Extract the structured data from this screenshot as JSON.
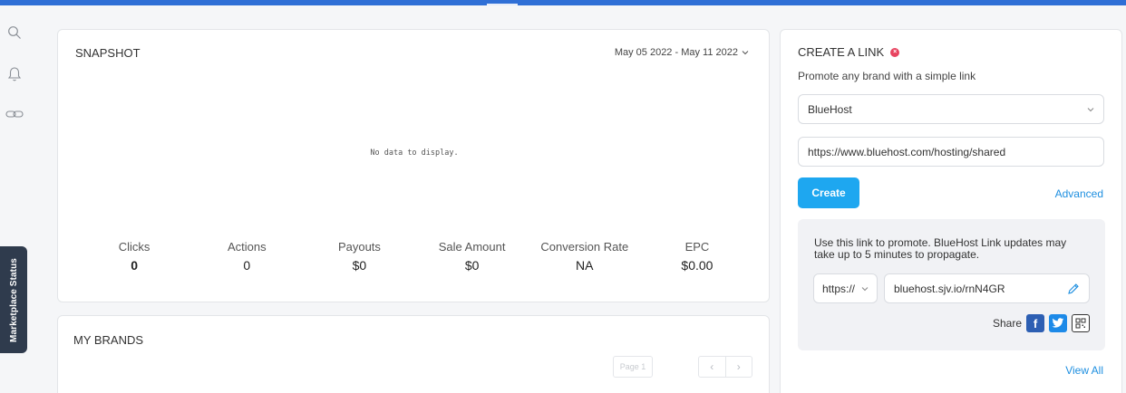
{
  "snapshot": {
    "title": "SNAPSHOT",
    "date_range": "May 05 2022 - May 11 2022",
    "empty_message": "No data to display.",
    "stats": [
      {
        "label": "Clicks",
        "value": "0"
      },
      {
        "label": "Actions",
        "value": "0"
      },
      {
        "label": "Payouts",
        "value": "$0"
      },
      {
        "label": "Sale Amount",
        "value": "$0"
      },
      {
        "label": "Conversion Rate",
        "value": "NA"
      },
      {
        "label": "EPC",
        "value": "$0.00"
      }
    ]
  },
  "brands": {
    "title": "MY BRANDS",
    "page_label": "Page 1",
    "prev": "‹",
    "next": "›"
  },
  "create_link": {
    "title": "CREATE A LINK",
    "subtitle": "Promote any brand with a simple link",
    "brand_select": "BlueHost",
    "destination_url": "https://www.bluehost.com/hosting/shared",
    "create_label": "Create",
    "advanced_label": "Advanced",
    "promo_text": "Use this link to promote. BlueHost Link updates may take up to 5 minutes to propagate.",
    "protocol": "https://",
    "short_url": "bluehost.sjv.io/rnN4GR",
    "share_label": "Share",
    "view_all_label": "View All"
  },
  "sidebar": {
    "marketplace_status": "Marketplace Status"
  },
  "colors": {
    "accent": "#2f6fd6",
    "button": "#1ea7f0",
    "link": "#1e8fe0",
    "badge": "#e8435f",
    "facebook": "#2d5fb3",
    "twitter": "#1d8ae8"
  },
  "icons": [
    "search-icon",
    "bell-icon",
    "link-icon",
    "chevron-down-icon",
    "pencil-icon",
    "facebook-icon",
    "twitter-icon",
    "qr-code-icon"
  ]
}
